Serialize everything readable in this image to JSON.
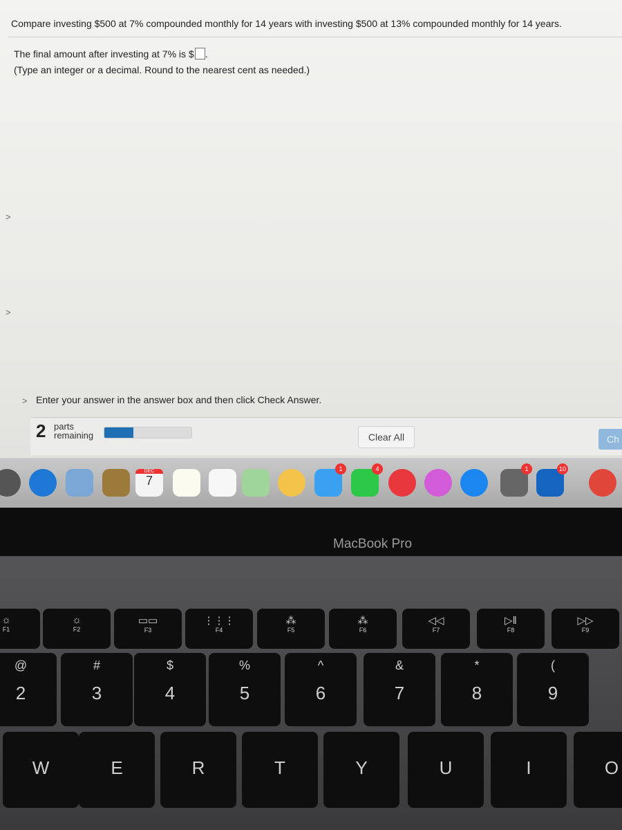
{
  "question": {
    "text": "Compare investing $500 at 7% compounded monthly for 14 years with investing $500 at 13% compounded monthly for 14 years.",
    "prompt": "The final amount after investing at 7% is $",
    "answer_value": "",
    "hint": "(Type an integer or a decimal. Round to the nearest cent as needed.)"
  },
  "footer": {
    "instruction": "Enter your answer in the answer box and then click Check Answer.",
    "parts_count": "2",
    "parts_label_1": "parts",
    "parts_label_2": "remaining",
    "progress_percent": 33,
    "clear_all": "Clear All",
    "check_answer": "Ch"
  },
  "dock": {
    "apps": [
      {
        "name": "launchpad",
        "color": "#555"
      },
      {
        "name": "safari",
        "color": "#1e78d6"
      },
      {
        "name": "preview",
        "color": "#7aa7d6"
      },
      {
        "name": "contacts",
        "color": "#9c7a3a"
      },
      {
        "name": "calendar",
        "color": "#f4f4f4",
        "month": "DEC",
        "day": "7"
      },
      {
        "name": "notes",
        "color": "#fbfbf0"
      },
      {
        "name": "reminders",
        "color": "#f7f7f7"
      },
      {
        "name": "maps",
        "color": "#9fd49a"
      },
      {
        "name": "photos",
        "color": "#f3c34a"
      },
      {
        "name": "messages",
        "color": "#3aa0f0",
        "badge": "1"
      },
      {
        "name": "facetime",
        "color": "#2ec848",
        "badge": "4"
      },
      {
        "name": "news",
        "color": "#e8383d"
      },
      {
        "name": "music",
        "color": "#d25cd8"
      },
      {
        "name": "app-store",
        "color": "#1b86f0"
      },
      {
        "name": "system-preferences",
        "color": "#666",
        "badge": "1"
      },
      {
        "name": "outlook",
        "color": "#1565c0",
        "badge": "10"
      },
      {
        "name": "chrome",
        "color": "#e0463a"
      }
    ]
  },
  "laptop": {
    "brand": "MacBook Pro"
  },
  "keyboard": {
    "fn_row": [
      {
        "label": "F1",
        "sym": "☼"
      },
      {
        "label": "F2",
        "sym": "☼"
      },
      {
        "label": "F3",
        "sym": "▭▭"
      },
      {
        "label": "F4",
        "sym": "⋮⋮⋮"
      },
      {
        "label": "F5",
        "sym": "⁂"
      },
      {
        "label": "F6",
        "sym": "⁂"
      },
      {
        "label": "F7",
        "sym": "◁◁"
      },
      {
        "label": "F8",
        "sym": "▷‖"
      },
      {
        "label": "F9",
        "sym": "▷▷"
      }
    ],
    "number_row": [
      {
        "top": "@",
        "bot": "2"
      },
      {
        "top": "#",
        "bot": "3"
      },
      {
        "top": "$",
        "bot": "4"
      },
      {
        "top": "%",
        "bot": "5"
      },
      {
        "top": "^",
        "bot": "6"
      },
      {
        "top": "&",
        "bot": "7"
      },
      {
        "top": "*",
        "bot": "8"
      },
      {
        "top": "(",
        "bot": "9"
      }
    ],
    "letter_row": [
      "W",
      "E",
      "R",
      "T",
      "Y",
      "U",
      "I",
      "O"
    ]
  }
}
